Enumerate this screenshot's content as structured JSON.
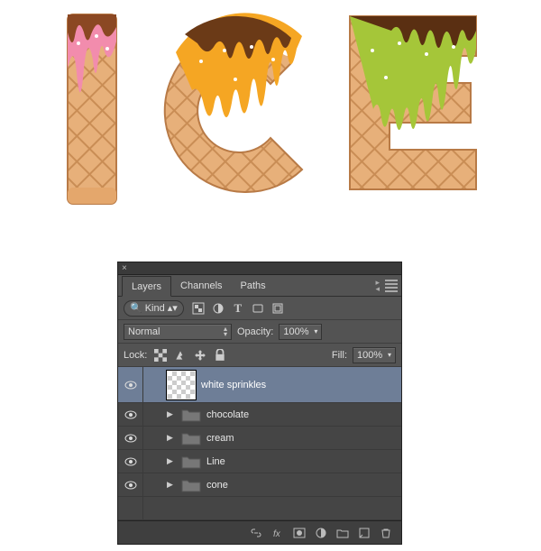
{
  "artwork": {
    "text": "ICE",
    "letter_I": {
      "drip_color": "#f28cad",
      "drip_dark": "#8b4823"
    },
    "letter_C": {
      "drip_color": "#f5a623",
      "drip_dark": "#6b3a17"
    },
    "letter_E": {
      "drip_color": "#a5c639",
      "drip_dark": "#5a2f12"
    },
    "waffle_light": "#e7b07a",
    "waffle_dark": "#c98d55",
    "sprinkle": "#ffffff"
  },
  "panel": {
    "tabs": [
      "Layers",
      "Channels",
      "Paths"
    ],
    "active_tab": 0,
    "close_glyph": "×",
    "kind": {
      "label": "Kind"
    },
    "blend_mode": "Normal",
    "opacity_label": "Opacity:",
    "opacity_value": "100%",
    "lock_label": "Lock:",
    "fill_label": "Fill:",
    "fill_value": "100%",
    "layers": [
      {
        "name": "white sprinkles",
        "type": "layer",
        "selected": true,
        "visible": true
      },
      {
        "name": "chocolate",
        "type": "group",
        "visible": true
      },
      {
        "name": "cream",
        "type": "group",
        "visible": true
      },
      {
        "name": "Line",
        "type": "group",
        "visible": true
      },
      {
        "name": "cone",
        "type": "group",
        "visible": true
      }
    ]
  }
}
